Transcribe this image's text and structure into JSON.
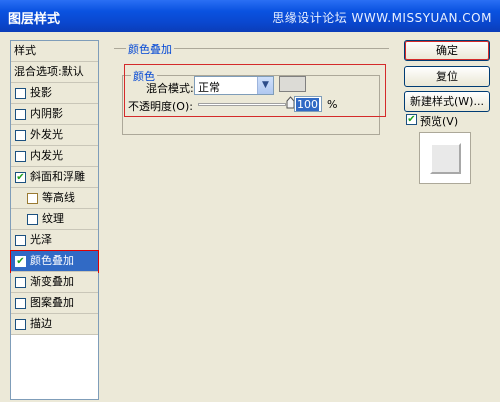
{
  "window": {
    "title": "图层样式",
    "watermark": "思缘设计论坛 WWW.MISSYUAN.COM"
  },
  "style_list": {
    "header": "样式",
    "blend_options": "混合选项:默认",
    "items": [
      {
        "label": "投影",
        "checked": false
      },
      {
        "label": "内阴影",
        "checked": false
      },
      {
        "label": "外发光",
        "checked": false
      },
      {
        "label": "内发光",
        "checked": false
      },
      {
        "label": "斜面和浮雕",
        "checked": true
      },
      {
        "label": "等高线",
        "checked": false
      },
      {
        "label": "纹理",
        "checked": false
      },
      {
        "label": "光泽",
        "checked": false
      },
      {
        "label": "颜色叠加",
        "checked": true
      },
      {
        "label": "渐变叠加",
        "checked": false
      },
      {
        "label": "图案叠加",
        "checked": false
      },
      {
        "label": "描边",
        "checked": false
      }
    ]
  },
  "panel": {
    "group_title": "颜色叠加",
    "subgroup_title": "颜色",
    "blend_mode_label": "混合模式:",
    "blend_mode_value": "正常",
    "opacity_label": "不透明度(O):",
    "opacity_value": "100",
    "opacity_unit": "%",
    "opacity_fraction": 1.0,
    "swatch_color": "#dcdbd6"
  },
  "buttons": {
    "ok": "确定",
    "reset": "复位",
    "new_style": "新建样式(W)...",
    "preview_label": "预览(V)"
  },
  "icons": {
    "checkmark": "check-icon",
    "dropdown": "chevron-down-icon"
  }
}
